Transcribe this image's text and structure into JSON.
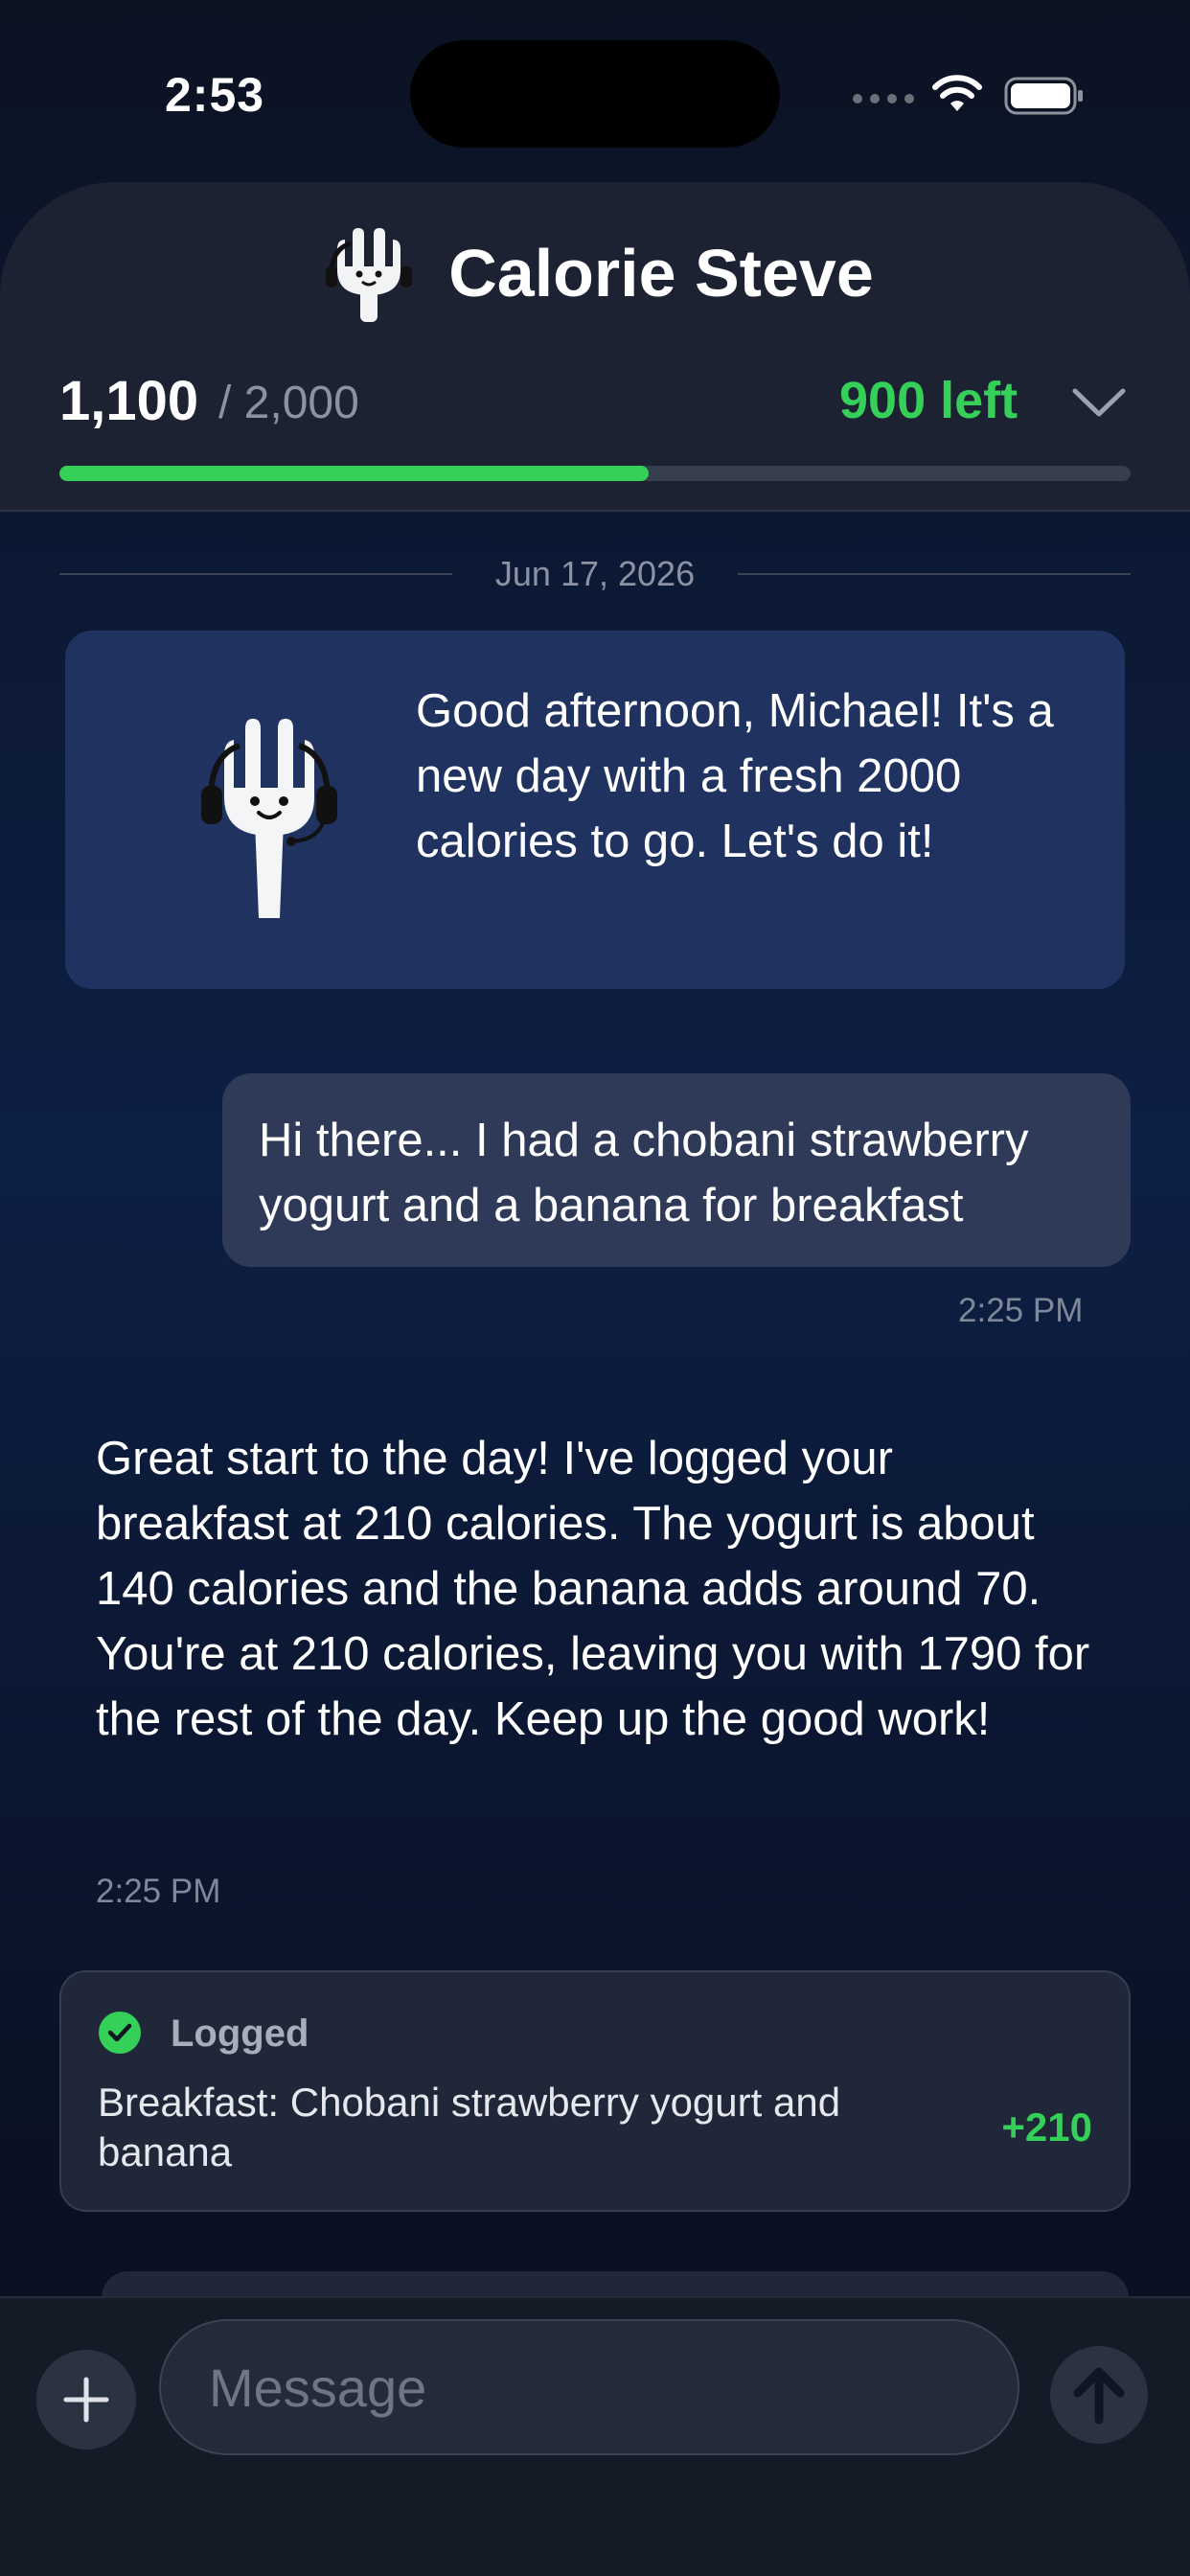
{
  "status_bar": {
    "time": "2:53"
  },
  "header": {
    "title": "Calorie Steve",
    "consumed": "1,100",
    "goal": "/ 2,000",
    "left": "900 left",
    "progress_fraction": 0.55
  },
  "chat": {
    "date": "Jun 17, 2026",
    "greeting": "Good afternoon, Michael! It's a new day with a fresh 2000 calories to go. Let's do it!",
    "user_message": "Hi there... I had a chobani strawberry yogurt and a banana for breakfast",
    "user_time": "2:25 PM",
    "assistant_message": "Great start to the day! I've logged your breakfast at 210 calories. The yogurt is about 140 calories and the banana adds around 70. You're at 210 calories, leaving you with 1790 for the rest of the day. Keep up the good work!",
    "assistant_time": "2:25 PM",
    "log": {
      "title": "Logged",
      "description": "Breakfast: Chobani strawberry yogurt and banana",
      "value": "+210"
    }
  },
  "input": {
    "placeholder": "Message"
  },
  "colors": {
    "accent_green": "#34d058",
    "greeting_card": "#1f3260",
    "user_bubble": "#2e3a58"
  }
}
